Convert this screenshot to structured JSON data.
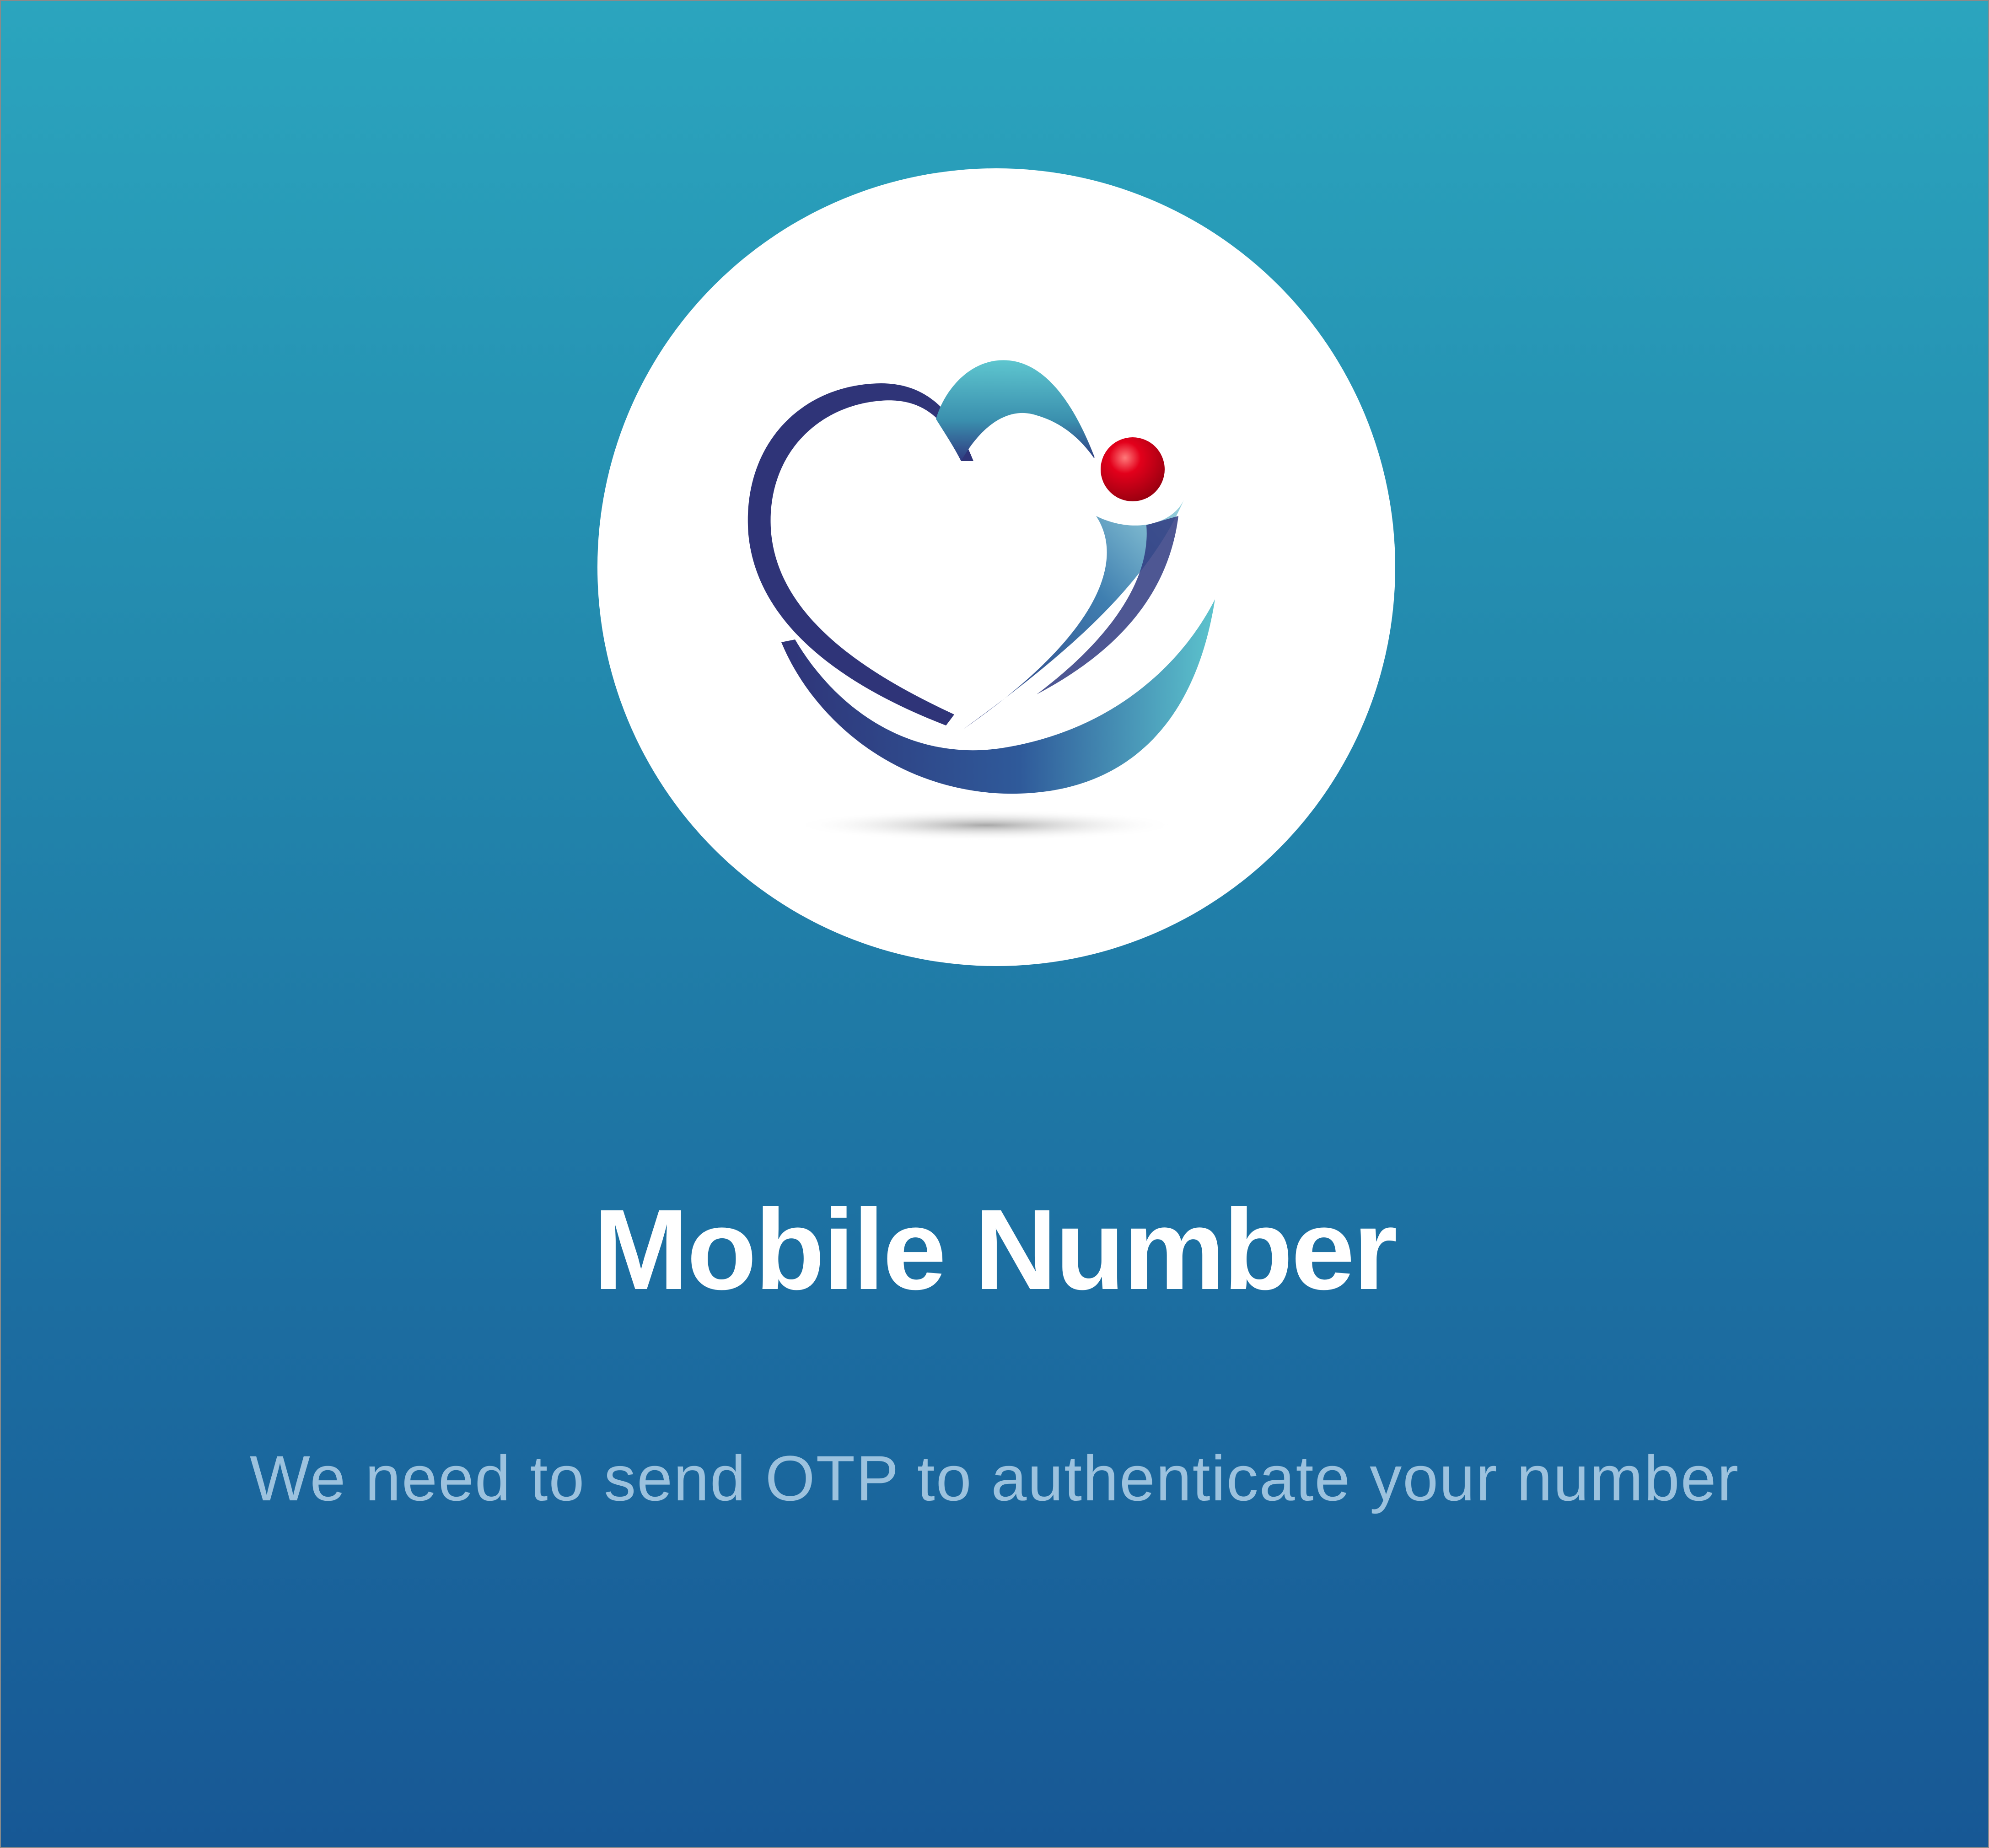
{
  "screen": {
    "title": "Mobile Number",
    "subtitle": "We need to send OTP to authenticate your number"
  },
  "logo": {
    "icon": "heart-logo-icon",
    "colors": {
      "navy": "#2f3478",
      "teal": "#5cc3cd",
      "red_dot": "#d3001b"
    }
  },
  "colors": {
    "gradient_top": "#2ba5be",
    "gradient_bottom": "#175895",
    "title": "#ffffff",
    "subtitle": "#9cc2de",
    "circle": "#ffffff"
  }
}
